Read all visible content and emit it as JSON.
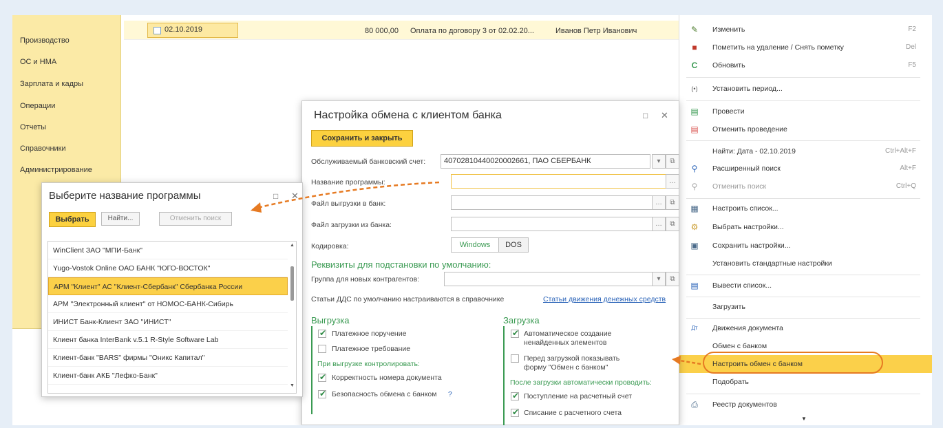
{
  "sidebar": {
    "items": [
      "Производство",
      "ОС и НМА",
      "Зарплата и кадры",
      "Операции",
      "Отчеты",
      "Справочники",
      "Администрирование"
    ]
  },
  "list": {
    "row": {
      "date": "02.10.2019",
      "amount": "80 000,00",
      "purpose": "Оплата по договору 3 от 02.02.20...",
      "person": "Иванов Петр Иванович"
    }
  },
  "menu": {
    "items": [
      {
        "label": "Изменить",
        "shortcut": "F2",
        "icon": "pencil-icon"
      },
      {
        "label": "Пометить на удаление / Снять пометку",
        "shortcut": "Del",
        "icon": "delete-mark-icon"
      },
      {
        "label": "Обновить",
        "shortcut": "F5",
        "icon": "refresh-icon"
      },
      {
        "label": "Установить период...",
        "shortcut": "",
        "icon": "period-icon"
      },
      {
        "label": "Провести",
        "shortcut": "",
        "icon": "post-icon"
      },
      {
        "label": "Отменить проведение",
        "shortcut": "",
        "icon": "unpost-icon"
      },
      {
        "label": "Найти: Дата - 02.10.2019",
        "shortcut": "Ctrl+Alt+F",
        "icon": ""
      },
      {
        "label": "Расширенный поиск",
        "shortcut": "Alt+F",
        "icon": "search-icon"
      },
      {
        "label": "Отменить поиск",
        "shortcut": "Ctrl+Q",
        "icon": "cancel-search-icon"
      },
      {
        "label": "Настроить список...",
        "shortcut": "",
        "icon": "list-settings-icon"
      },
      {
        "label": "Выбрать настройки...",
        "shortcut": "",
        "icon": "choose-settings-icon"
      },
      {
        "label": "Сохранить настройки...",
        "shortcut": "",
        "icon": "save-settings-icon"
      },
      {
        "label": "Установить стандартные настройки",
        "shortcut": "",
        "icon": ""
      },
      {
        "label": "Вывести список...",
        "shortcut": "",
        "icon": "output-list-icon"
      },
      {
        "label": "Загрузить",
        "shortcut": "",
        "icon": ""
      },
      {
        "label": "Движения документа",
        "shortcut": "",
        "icon": "movements-icon"
      },
      {
        "label": "Обмен с банком",
        "shortcut": "",
        "icon": ""
      },
      {
        "label": "Настроить обмен с банком",
        "shortcut": "",
        "icon": ""
      },
      {
        "label": "Подобрать",
        "shortcut": "",
        "icon": ""
      },
      {
        "label": "Реестр документов",
        "shortcut": "",
        "icon": "printer-icon"
      }
    ]
  },
  "settings": {
    "title": "Настройка обмена с клиентом банка",
    "save_close": "Сохранить и закрыть",
    "account_label": "Обслуживаемый банковский счет:",
    "account_value": "40702810440020002661, ПАО СБЕРБАНК",
    "program_label": "Название программы:",
    "export_file_label": "Файл выгрузки в банк:",
    "import_file_label": "Файл загрузки из банка:",
    "encoding_label": "Кодировка:",
    "encoding_windows": "Windows",
    "encoding_dos": "DOS",
    "defaults_header": "Реквизиты для подстановки по умолчанию:",
    "group_label": "Группа для новых контрагентов:",
    "dds_text": "Статьи ДДС по умолчанию настраиваются в справочнике",
    "dds_link": "Статьи движения денежных средств",
    "export": {
      "header": "Выгрузка",
      "payment_order": "Платежное поручение",
      "payment_request": "Платежное требование",
      "control_header": "При выгрузке контролировать:",
      "doc_number": "Корректность номера документа",
      "security": "Безопасность обмена с банком",
      "help": "?"
    },
    "import": {
      "header": "Загрузка",
      "auto_create_1": "Автоматическое создание",
      "auto_create_2": "ненайденных элементов",
      "show_form_1": "Перед загрузкой показывать",
      "show_form_2": "форму \"Обмен с банком\"",
      "post_header": "После загрузки автоматически проводить:",
      "receipt": "Поступление на расчетный счет",
      "writeoff": "Списание с расчетного счета"
    }
  },
  "select": {
    "title": "Выберите название программы",
    "choose": "Выбрать",
    "find": "Найти...",
    "cancel_search": "Отменить поиск",
    "items": [
      "WinClient ЗАО \"МПИ-Банк\"",
      "Yugo-Vostok Online ОАО БАНК \"ЮГО-ВОСТОК\"",
      "АРМ \"Клиент\" АС \"Клиент-Сбербанк\" Сбербанка России",
      "АРМ \"Электронный клиент\" от НОМОС-БАНК-Сибирь",
      "ИНИСТ Банк-Клиент ЗАО \"ИНИСТ\"",
      "Клиент банка InterBank v.5.1 R-Style Software Lab",
      "Клиент-банк \"BARS\" фирмы \"Оникс Капитал\"",
      "Клиент-банк АКБ \"Лефко-Банк\""
    ]
  },
  "colors": {
    "accent": "#fbd04a",
    "green": "#3a9a52",
    "arrow": "#e67a22"
  }
}
